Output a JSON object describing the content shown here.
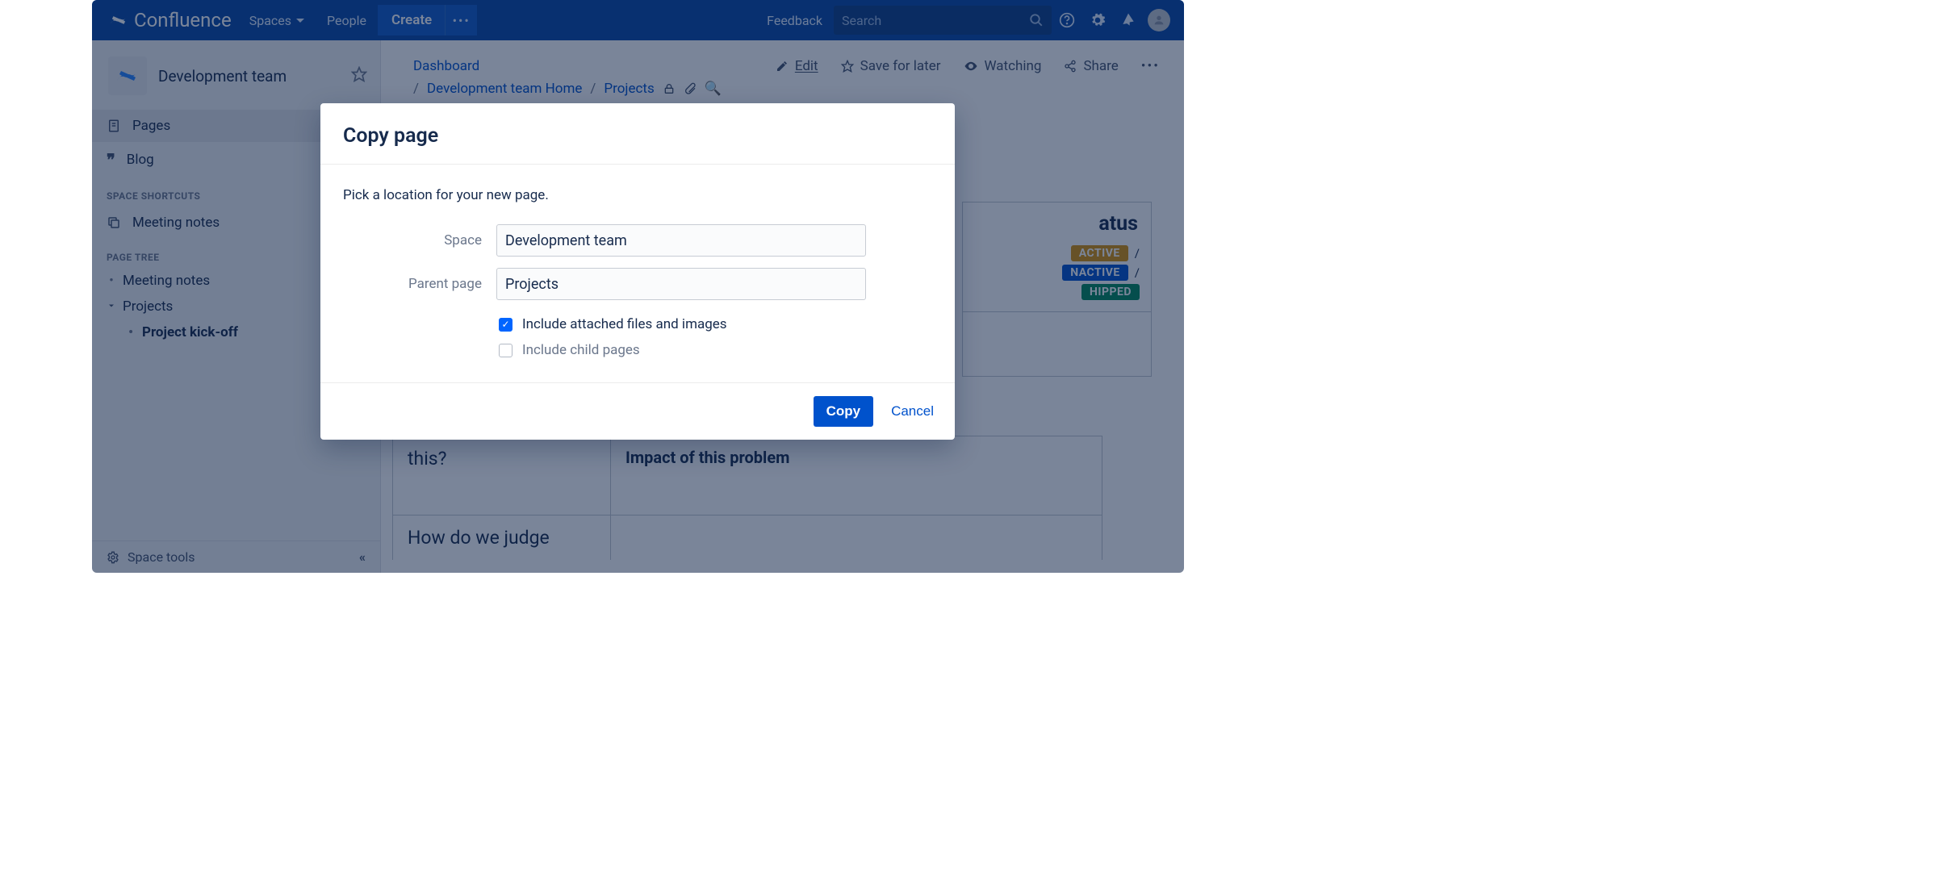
{
  "nav": {
    "brand": "Confluence",
    "spaces": "Spaces",
    "people": "People",
    "create": "Create",
    "feedback": "Feedback",
    "search_placeholder": "Search"
  },
  "sidebar": {
    "space_name": "Development team",
    "pages": "Pages",
    "blog": "Blog",
    "shortcuts_label": "SPACE SHORTCUTS",
    "meeting_notes": "Meeting notes",
    "tree_label": "PAGE TREE",
    "tree": {
      "meeting": "Meeting notes",
      "projects": "Projects",
      "kickoff": "Project kick-off"
    },
    "space_tools": "Space tools"
  },
  "breadcrumbs": {
    "dashboard": "Dashboard",
    "home": "Development team Home",
    "projects": "Projects"
  },
  "actions": {
    "edit": "Edit",
    "save": "Save for later",
    "watching": "Watching",
    "share": "Share"
  },
  "status_panel": {
    "title": "atus",
    "badge_active": "ACTIVE",
    "badge_inactive": "NACTIVE",
    "badge_shipped": "HIPPED"
  },
  "page_cells": {
    "q1": "this?",
    "q2": "How do we judge",
    "impact": "Impact of this problem"
  },
  "dialog": {
    "title": "Copy page",
    "desc": "Pick a location for your new page.",
    "space_label": "Space",
    "space_value": "Development team",
    "parent_label": "Parent page",
    "parent_value": "Projects",
    "chk_files": "Include attached files and images",
    "chk_children": "Include child pages",
    "copy": "Copy",
    "cancel": "Cancel"
  }
}
